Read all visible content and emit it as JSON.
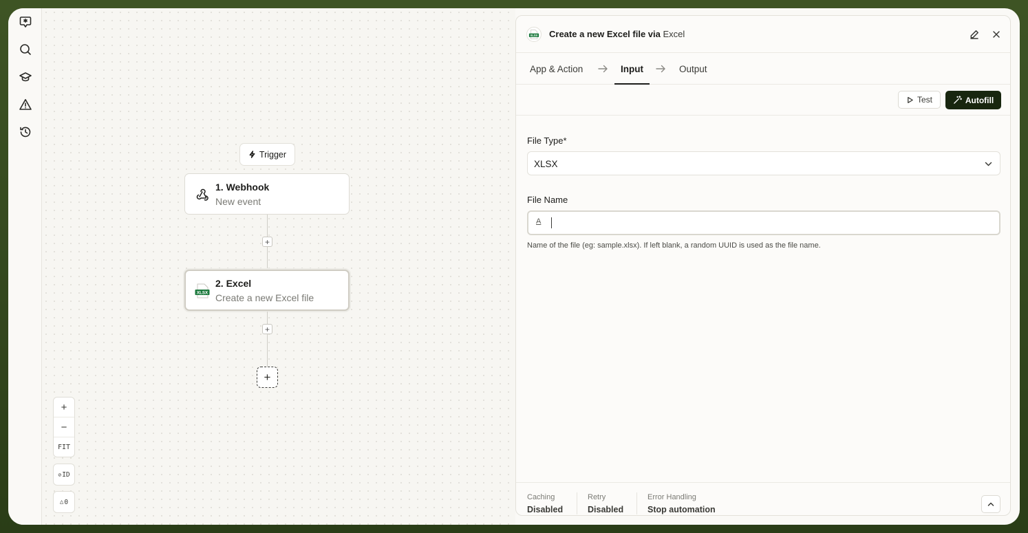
{
  "rail": {
    "items": [
      {
        "icon": "chat-star-icon"
      },
      {
        "icon": "search-icon"
      },
      {
        "icon": "graduation-cap-icon"
      },
      {
        "icon": "warning-icon"
      },
      {
        "icon": "history-icon"
      }
    ]
  },
  "canvas": {
    "trigger_label": "Trigger",
    "nodes": [
      {
        "title": "1. Webhook",
        "subtitle": "New event",
        "icon": "webhook-icon"
      },
      {
        "title": "2. Excel",
        "subtitle": "Create a new Excel file",
        "icon": "xlsx-icon",
        "icon_text": "XLSX"
      }
    ],
    "add_step_symbol": "+",
    "controls": {
      "zoom_in": "+",
      "zoom_out": "−",
      "fit": "FIT",
      "id_toggle": "ID",
      "warnings_count": "0"
    }
  },
  "panel": {
    "title": "Create a new Excel file via",
    "app_name": "Excel",
    "app_logo_text": "XLSX",
    "tabs": [
      {
        "label": "App & Action"
      },
      {
        "label": "Input",
        "active": true
      },
      {
        "label": "Output"
      }
    ],
    "test_label": "Test",
    "autofill_label": "Autofill",
    "file_type": {
      "label": "File Type*",
      "value": "XLSX"
    },
    "file_name": {
      "label": "File Name",
      "value": "",
      "type_icon": "A",
      "help": "Name of the file (eg: sample.xlsx). If left blank, a random UUID is used as the file name."
    },
    "footer": {
      "items": [
        {
          "key": "Caching",
          "value": "Disabled"
        },
        {
          "key": "Retry",
          "value": "Disabled"
        },
        {
          "key": "Error Handling",
          "value": "Stop automation"
        }
      ]
    }
  },
  "colors": {
    "accent_dark": "#18260f",
    "excel_green": "#1d7a3e",
    "frame_bg": "#3e5424"
  }
}
